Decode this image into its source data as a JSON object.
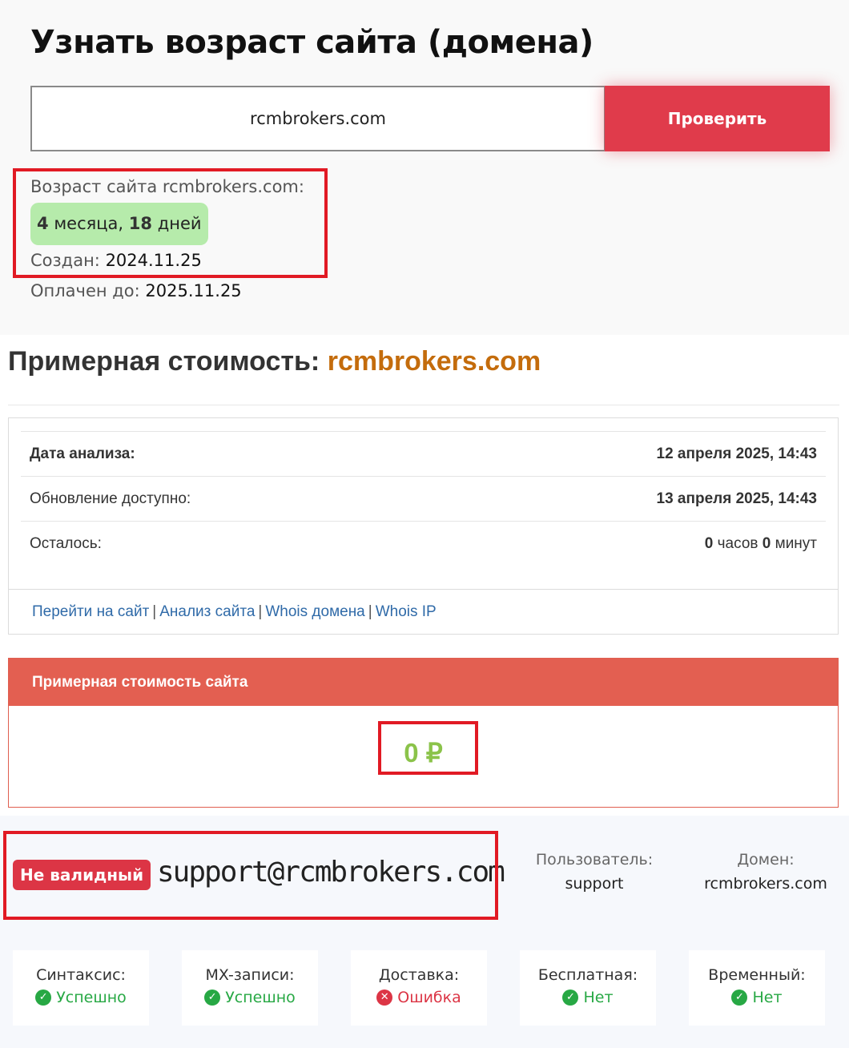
{
  "age_check": {
    "title": "Узнать возраст сайта (домена)",
    "input_value": "rcmbrokers.com",
    "button_label": "Проверить",
    "age_label": "Возраст сайта rcmbrokers.com:",
    "age_badge": {
      "num1": "4",
      "unit1": "месяца,",
      "num2": "18",
      "unit2": "дней"
    },
    "created_label": "Создан:",
    "created_value": "2024.11.25",
    "paid_label": "Оплачен до:",
    "paid_value": "2025.11.25"
  },
  "cost": {
    "heading_label": "Примерная стоимость:",
    "heading_domain": "rcmbrokers.com",
    "rows": [
      {
        "label": "Дата анализа:",
        "value": "12 апреля 2025, 14:43"
      },
      {
        "label": "Обновление доступно:",
        "value": "13 апреля 2025, 14:43"
      },
      {
        "label": "Осталось:",
        "hours": "0",
        "hours_unit": "часов",
        "minutes": "0",
        "minutes_unit": "минут"
      }
    ],
    "links": [
      "Перейти на сайт",
      "Анализ сайта",
      "Whois домена",
      "Whois IP"
    ],
    "link_separator": "|",
    "price_panel_title": "Примерная стоимость сайта",
    "price_value": "0 ₽"
  },
  "email_check": {
    "status_badge": "Не валидный",
    "email": "support@rcmbrokers.com",
    "user_label": "Пользователь:",
    "user_value": "support",
    "domain_label": "Домен:",
    "domain_value": "rcmbrokers.com",
    "stats": [
      {
        "label": "Синтаксис:",
        "value": "Успешно",
        "status": "ok",
        "icon": "check-circle-icon"
      },
      {
        "label": "MX-записи:",
        "value": "Успешно",
        "status": "ok",
        "icon": "check-circle-icon"
      },
      {
        "label": "Доставка:",
        "value": "Ошибка",
        "status": "error",
        "icon": "x-circle-icon"
      },
      {
        "label": "Бесплатная:",
        "value": "Нет",
        "status": "ok",
        "icon": "check-circle-icon"
      },
      {
        "label": "Временный:",
        "value": "Нет",
        "status": "ok",
        "icon": "check-circle-icon"
      }
    ]
  },
  "colors": {
    "accent_button": "#e03b4b",
    "annotation_box": "#e11a24",
    "age_badge_bg": "#b6ebab",
    "domain_orange": "#c46c0c",
    "price_header": "#e35f51",
    "price_value": "#8bc34a",
    "status_ok": "#27a844",
    "status_error": "#dc3545"
  }
}
